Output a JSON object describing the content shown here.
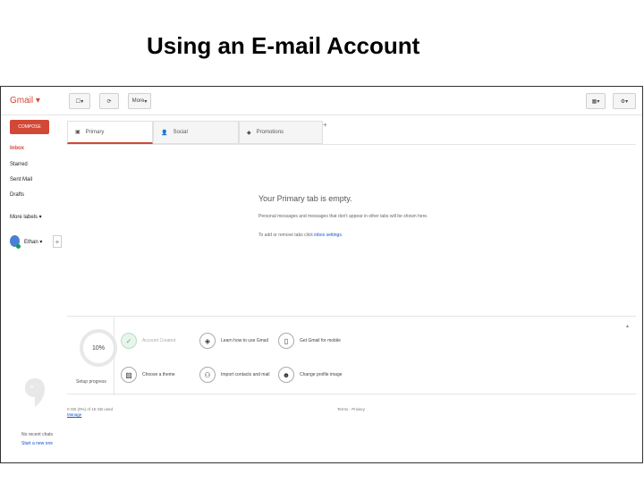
{
  "slide": {
    "title": "Using an E-mail Account"
  },
  "toolbar": {
    "logo": "Gmail",
    "more_label": "More"
  },
  "sidebar": {
    "compose": "COMPOSE",
    "items": [
      {
        "label": "Inbox",
        "active": true
      },
      {
        "label": "Starred",
        "active": false
      },
      {
        "label": "Sent Mail",
        "active": false
      },
      {
        "label": "Drafts",
        "active": false
      },
      {
        "label": "More labels",
        "active": false
      }
    ],
    "user_name": "Ethan",
    "chats_empty": "No recent chats",
    "chats_link": "Start a new one"
  },
  "tabs": [
    {
      "label": "Primary",
      "icon": "inbox-icon",
      "active": true
    },
    {
      "label": "Social",
      "icon": "people-icon",
      "active": false
    },
    {
      "label": "Promotions",
      "icon": "tag-icon",
      "active": false
    }
  ],
  "empty_state": {
    "title": "Your Primary tab is empty.",
    "line1": "Personal messages and messages that don't appear in other tabs will be shown here.",
    "line2_prefix": "To add or remove tabs click ",
    "line2_link": "inbox settings",
    "line2_suffix": "."
  },
  "progress": {
    "percent_label": "10%",
    "caption": "Setup progress",
    "tasks": [
      {
        "label": "Account Created",
        "icon": "check-icon",
        "done": true
      },
      {
        "label": "Learn how to use Gmail",
        "icon": "layers-icon",
        "done": false
      },
      {
        "label": "Get Gmail for mobile",
        "icon": "phone-icon",
        "done": false
      },
      {
        "label": "Choose a theme",
        "icon": "image-icon",
        "done": false
      },
      {
        "label": "Import contacts and mail",
        "icon": "contacts-icon",
        "done": false
      },
      {
        "label": "Change profile image",
        "icon": "profile-icon",
        "done": false
      }
    ]
  },
  "footer": {
    "storage": "0 GB (0%) of 15 GB used",
    "manage": "Manage",
    "terms": "Terms - Privacy"
  },
  "colors": {
    "accent": "#d14836",
    "link": "#1155cc",
    "success": "#57b868"
  }
}
